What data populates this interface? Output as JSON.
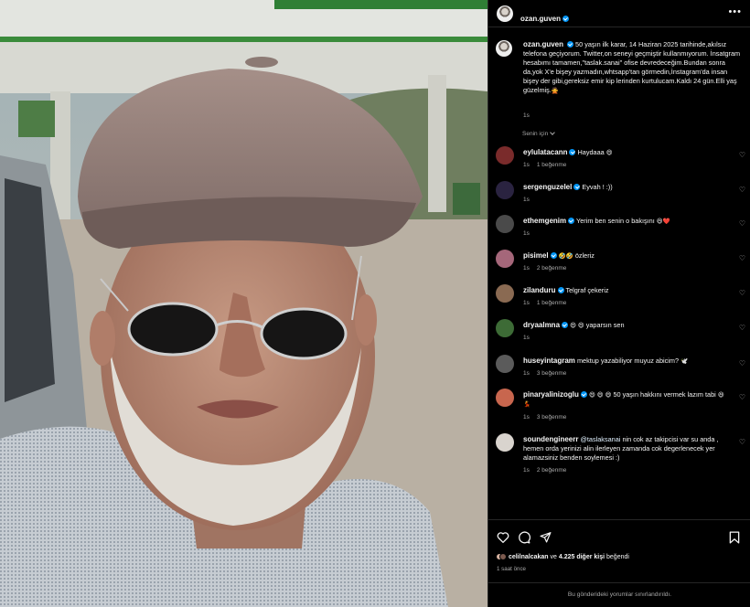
{
  "post": {
    "username": "ozan.guven",
    "verified": true,
    "caption": "50 yaşın ilk karar, 14 Haziran 2025 tarihinde,akılsız telefona geçiyorum. Twitter,on seneyi geçmiştir kullanmıyorum. İnsatgram hesabımı tamamen,\"taslak.sanai\" ofise devredeceğim.Bundan sonra da,yok X'e bişey yazmadın,whtsapp'tan görmedin,İnstagram'da insan bişey der gibi,gereksiz emir kip lerinden kurtulucam.Kaldı 24 gün.Elli yaş güzelmiş.",
    "caption_emoji": "🙅",
    "caption_time": "1s",
    "sort_label": "Senin için"
  },
  "comments": [
    {
      "username": "eylulatacann",
      "verified": true,
      "text": "Haydaaa",
      "emoji": "😄",
      "time": "1s",
      "likes": "1 beğenme",
      "avatar_color": "#7a2b2b"
    },
    {
      "username": "sergenguzelel",
      "verified": true,
      "text": "Eyvah ! :))",
      "emoji": "",
      "time": "1s",
      "likes": "",
      "avatar_color": "#2a2340"
    },
    {
      "username": "ethemgenim",
      "verified": true,
      "text": "Yerim ben senin o bakışını",
      "emoji": "😆❤️",
      "time": "1s",
      "likes": "",
      "avatar_color": "#4a4a4a"
    },
    {
      "username": "pisimel",
      "verified": true,
      "text": "özleriz",
      "emoji": "🤣🤣",
      "time": "1s",
      "likes": "2 beğenme",
      "avatar_color": "#a5677a"
    },
    {
      "username": "zilanduru",
      "verified": true,
      "text": "Telgraf çekeriz",
      "emoji": "",
      "time": "1s",
      "likes": "1 beğenme",
      "avatar_color": "#8a6a52"
    },
    {
      "username": "dryaalmna",
      "verified": true,
      "text": "yaparsın sen",
      "emoji": "😄 😄",
      "time": "1s",
      "likes": "",
      "avatar_color": "#3d6b36"
    },
    {
      "username": "huseyintagram",
      "verified": false,
      "text": "mektup yazabiliyor muyuz abicim?",
      "emoji": "🕊️",
      "time": "1s",
      "likes": "3 beğenme",
      "avatar_color": "#5b5b5b"
    },
    {
      "username": "pinaryalinizoglu",
      "verified": true,
      "text": "50 yaşın hakkını vermek lazım tabi",
      "emoji": "😄 😄 😄",
      "emoji_after": "😆 💃",
      "time": "1s",
      "likes": "3 beğenme",
      "avatar_color": "#c8664e"
    },
    {
      "username": "soundengineerr",
      "verified": false,
      "mention": "@taslaksanai",
      "text": "nin cok az takipcisi var su anda , hemen orda yerinizi alin ilerleyen zamanda cok degerlenecek yer alamazsiniz benden soylemesi :)",
      "emoji": "",
      "time": "1s",
      "likes": "2 beğenme",
      "avatar_color": "#d9d4ce"
    }
  ],
  "footer": {
    "likes_prefix": "celilnalcakan",
    "likes_middle": "ve",
    "likes_count": "4.225 diğer kişi",
    "likes_suffix": "beğendi",
    "post_time": "1 saat önce",
    "comments_limited": "Bu gönderideki yorumlar sınırlandırıldı."
  },
  "icons": {
    "more": "more-options-icon",
    "like": "heart-icon",
    "comment": "comment-icon",
    "share": "share-icon",
    "save": "bookmark-icon"
  },
  "colors": {
    "verified": "#0095f6",
    "muted": "#a8a8a8",
    "background": "#000000"
  }
}
